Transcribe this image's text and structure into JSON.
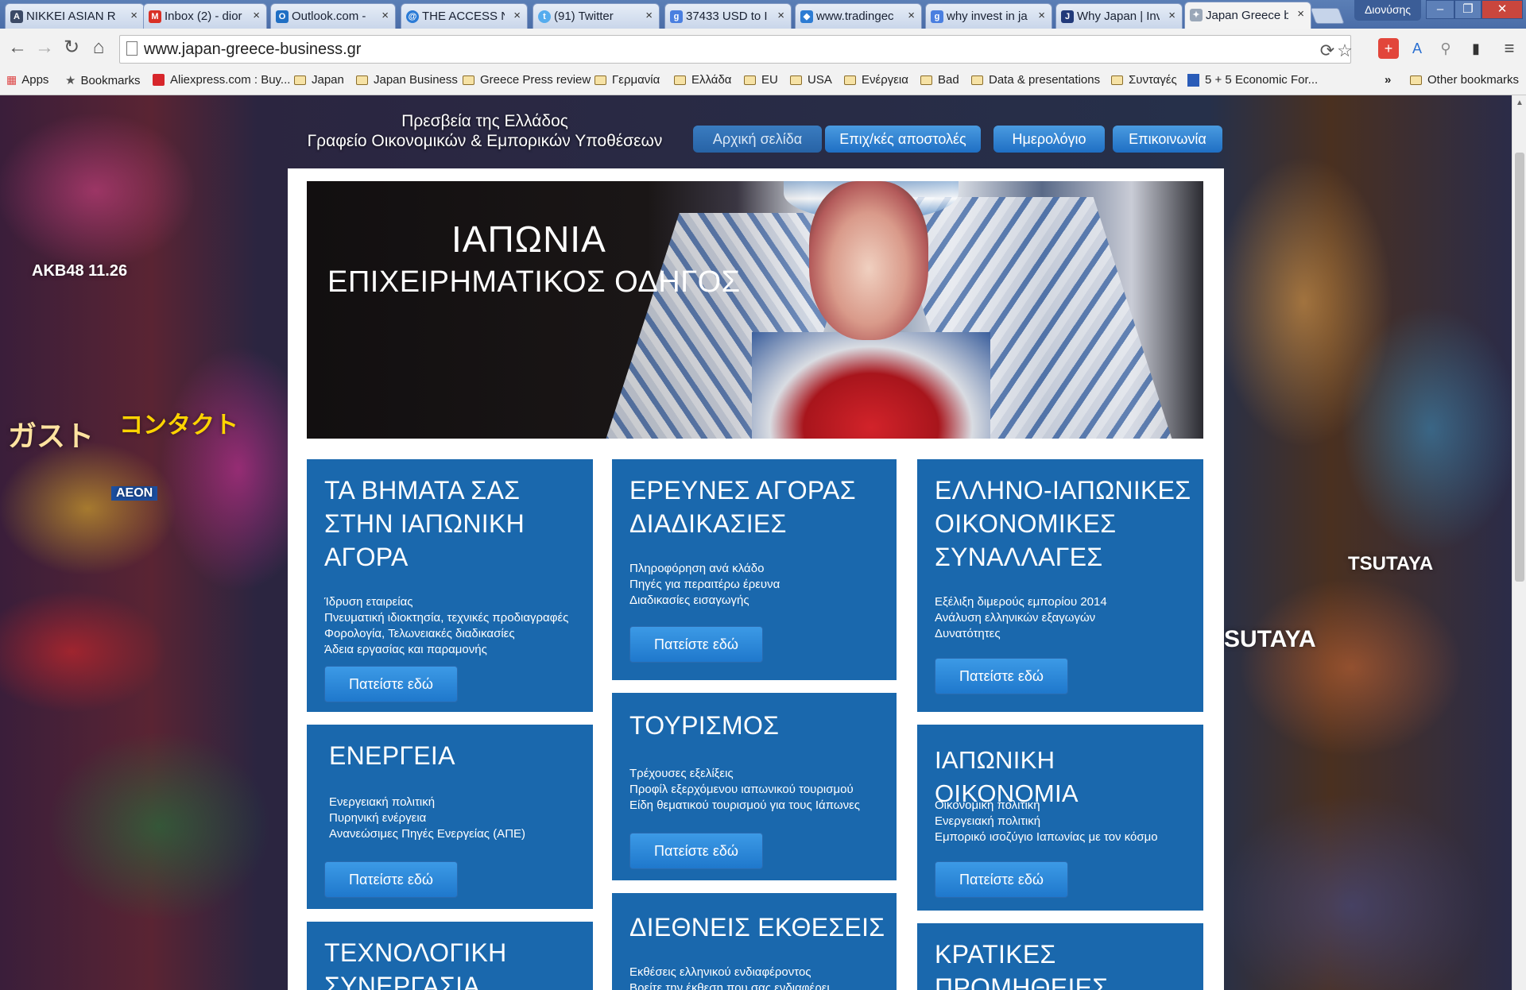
{
  "browser": {
    "tabs": [
      {
        "label": "NIKKEI ASIAN R",
        "icon": "nikkei-icon",
        "color": "#3c4a66"
      },
      {
        "label": "Inbox (2) - dior",
        "icon": "gmail-icon",
        "color": "#d93025"
      },
      {
        "label": "Outlook.com -",
        "icon": "outlook-icon",
        "color": "#1f6fc4"
      },
      {
        "label": "THE ACCESS N",
        "icon": "access-icon",
        "color": "#2b7bd6"
      },
      {
        "label": "(91) Twitter",
        "icon": "twitter-icon",
        "color": "#55acee"
      },
      {
        "label": "37433 USD to I",
        "icon": "google-icon",
        "color": "#4a7fe0"
      },
      {
        "label": "www.tradingec",
        "icon": "dropbox-icon",
        "color": "#2d7cd3"
      },
      {
        "label": "why invest in ja",
        "icon": "google-icon",
        "color": "#4a7fe0"
      },
      {
        "label": "Why Japan | Inv",
        "icon": "jetro-icon",
        "color": "#223a7a"
      },
      {
        "label": "Japan Greece b",
        "icon": "site-icon",
        "color": "#9aa7b8"
      }
    ],
    "user_name": "Διονύσης",
    "url": "www.japan-greece-business.gr",
    "bookmarks": [
      {
        "label": "Apps",
        "icon": "apps-grid-icon"
      },
      {
        "label": "Bookmarks",
        "icon": "star-icon"
      },
      {
        "label": "Aliexpress.com : Buy...",
        "icon": "aliexpress-icon"
      },
      {
        "label": "Japan",
        "icon": "folder-icon"
      },
      {
        "label": "Japan Business",
        "icon": "folder-icon"
      },
      {
        "label": "Greece Press review",
        "icon": "folder-icon"
      },
      {
        "label": "Γερμανία",
        "icon": "folder-icon"
      },
      {
        "label": "Ελλάδα",
        "icon": "folder-icon"
      },
      {
        "label": "EU",
        "icon": "folder-icon"
      },
      {
        "label": "USA",
        "icon": "folder-icon"
      },
      {
        "label": "Ενέργεια",
        "icon": "folder-icon"
      },
      {
        "label": "Bad",
        "icon": "folder-icon"
      },
      {
        "label": "Data & presentations",
        "icon": "folder-icon"
      },
      {
        "label": "Συνταγές",
        "icon": "folder-icon"
      },
      {
        "label": "5 + 5 Economic For...",
        "icon": "site-icon"
      }
    ],
    "bookmarks_overflow": "»",
    "other_bookmarks": "Other bookmarks"
  },
  "site": {
    "title_line1": "Πρεσβεία της Ελλάδος",
    "title_line2": "Γραφείο Οικονομικών & Εμπορικών Υποθέσεων",
    "nav": [
      {
        "label": "Αρχική σελίδα",
        "active": true
      },
      {
        "label": "Επιχ/κές αποστολές",
        "active": false
      },
      {
        "label": "Ημερολόγιο",
        "active": false
      },
      {
        "label": "Επικοινωνία",
        "active": false
      }
    ],
    "hero": {
      "line1": "ΙΑΠΩΝΙΑ",
      "line2": "ΕΠΙΧΕΙΡΗΜΑΤΙΚΟΣ ΟΔΗΓΟΣ"
    },
    "cta_label": "Πατείστε εδώ",
    "cards": {
      "steps": {
        "title": [
          "ΤΑ ΒΗΜΑΤΑ ΣΑΣ",
          "ΣΤΗΝ ΙΑΠΩΝΙΚΗ",
          "ΑΓΟΡΑ"
        ],
        "lines": [
          "Ίδρυση εταιρείας",
          "Πνευματική ιδιοκτησία,  τεχνικές προδιαγραφές",
          "Φορολογία, Τελωνειακές διαδικασίες",
          "Άδεια εργασίας και παραμονής"
        ]
      },
      "market_research": {
        "title": [
          "ΕΡΕΥΝΕΣ ΑΓΟΡΑΣ",
          "ΔΙΑΔΙΚΑΣΙΕΣ"
        ],
        "lines": [
          "Πληροφόρηση ανά κλάδο",
          "Πηγές για περαιτέρω έρευνα",
          "Διαδικασίες εισαγωγής"
        ]
      },
      "greek_japanese": {
        "title": [
          "ΕΛΛΗΝΟ-ΙΑΠΩΝΙΚΕΣ",
          "ΟΙΚΟΝΟΜΙΚΕΣ",
          "ΣΥΝΑΛΛΑΓΕΣ"
        ],
        "lines": [
          "Εξέλιξη διμερούς εμπορίου 2014",
          "Ανάλυση ελληνικών εξαγωγών",
          "Δυνατότητες"
        ]
      },
      "energy": {
        "title": [
          "ΕΝΕΡΓΕΙΑ"
        ],
        "lines": [
          "Ενεργειακή πολιτική",
          "Πυρηνική ενέργεια",
          "Ανανεώσιμες Πηγές Ενεργείας (ΑΠΕ)"
        ]
      },
      "tourism": {
        "title": [
          "ΤΟΥΡΙΣΜΟΣ"
        ],
        "lines": [
          "Τρέχουσες εξελίξεις",
          "Προφίλ εξερχόμενου ιαπωνικού  τουρισμού",
          "Είδη θεματικού τουρισμού για τους Ιάπωνες"
        ]
      },
      "economy": {
        "title": [
          "ΙΑΠΩΝΙΚΗ ΟΙΚΟΝΟΜΙΑ"
        ],
        "lines": [
          "Οικονομική πολιτική",
          "Ενεργειακή πολιτική",
          "Εμπορικό ισοζύγιο Ιαπωνίας με τον κόσμο"
        ]
      },
      "technology": {
        "title": [
          "ΤΕΧΝΟΛΟΓΙΚΗ",
          "ΣΥΝΕΡΓΑΣΙΑ"
        ]
      },
      "exhibitions": {
        "title": [
          "ΔΙΕΘΝΕΙΣ ΕΚΘΕΣΕΙΣ"
        ],
        "lines": [
          "Εκθέσεις ελληνικού ενδιαφέροντος",
          "Βρείτε την έκθεση που σας ενδιαφέρει"
        ]
      },
      "procurement": {
        "title": [
          "ΚΡΑΤΙΚΕΣ",
          "ΠΡΟΜΗΘΕΙΕΣ"
        ]
      }
    }
  },
  "background_signs": [
    "AKB48 11.26",
    "ガスト",
    "コンタクト",
    "AEON",
    "TSUTAYA",
    "SUTAYA"
  ],
  "colors": {
    "card_blue": "#1a68ad",
    "button_blue": "#2a86d8",
    "nav_blue": "#2c7cd0"
  }
}
